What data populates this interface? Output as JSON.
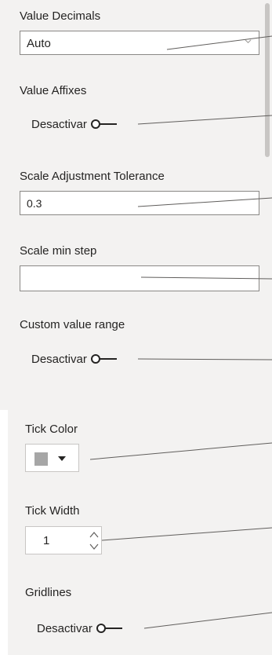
{
  "value_decimals": {
    "label": "Value Decimals",
    "selected": "Auto"
  },
  "value_affixes": {
    "label": "Value Affixes",
    "toggle_state": "Desactivar"
  },
  "scale_adjustment_tolerance": {
    "label": "Scale Adjustment Tolerance",
    "value": "0.3"
  },
  "scale_min_step": {
    "label": "Scale min step",
    "value": ""
  },
  "custom_value_range": {
    "label": "Custom value range",
    "toggle_state": "Desactivar"
  },
  "tick_color": {
    "label": "Tick Color",
    "swatch_color": "#a6a6a6"
  },
  "tick_width": {
    "label": "Tick Width",
    "value": "1"
  },
  "gridlines": {
    "label": "Gridlines",
    "toggle_state": "Desactivar"
  },
  "colors": {
    "pane_background": "#f3f2f1",
    "border": "#8a8886",
    "leader_line": "#605e5c"
  }
}
